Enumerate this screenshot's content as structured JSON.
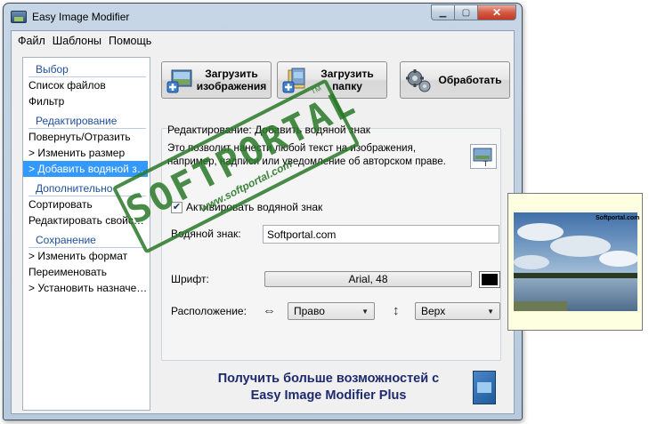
{
  "window": {
    "title": "Easy Image Modifier"
  },
  "menu": [
    "Файл",
    "Шаблоны",
    "Помощь"
  ],
  "sidebar": {
    "sections": [
      {
        "title": "Выбор",
        "items": [
          "Список файлов",
          "Фильтр"
        ]
      },
      {
        "title": "Редактирование",
        "items": [
          "Повернуть/Отразить",
          "> Изменить размер",
          "> Добавить водяной знак"
        ]
      },
      {
        "title": "Дополнительно",
        "items": [
          "Сортировать",
          "Редактировать свойства"
        ]
      },
      {
        "title": "Сохранение",
        "items": [
          "> Изменить формат",
          "Переименовать",
          "> Установить назначение"
        ]
      }
    ],
    "selected_item": "> Добавить водяной знак"
  },
  "toolbar": {
    "load_images": "Загрузить изображения",
    "load_folder": "Загрузить папку",
    "process": "Обработать"
  },
  "panel": {
    "title": "Редактирование: Добавить водяной знак",
    "description": "Это позволит нанести любой текст на изображения, например, надписи или уведомление об авторском праве.",
    "enable_label": "Активировать водяной знак",
    "enable_checked": true,
    "watermark_label": "Водяной знак:",
    "watermark_value": "Softportal.com",
    "font_label": "Шрифт:",
    "font_value": "Arial, 48",
    "font_color": "#000000",
    "position_label": "Расположение:",
    "horizontal_value": "Право",
    "vertical_value": "Верх"
  },
  "promo": {
    "line1": "Получить больше возможностей с",
    "line2": "Easy Image Modifier Plus"
  },
  "stamp": {
    "brand": "SOFTPORTAL",
    "tm": "TM",
    "url": "www.softportal.com"
  },
  "preview": {
    "caption": "Softportal.com"
  },
  "colors": {
    "selection": "#3399ff",
    "section_title": "#1f4f9a",
    "promo_text": "#1e2a6e",
    "stamp": "#287828"
  }
}
